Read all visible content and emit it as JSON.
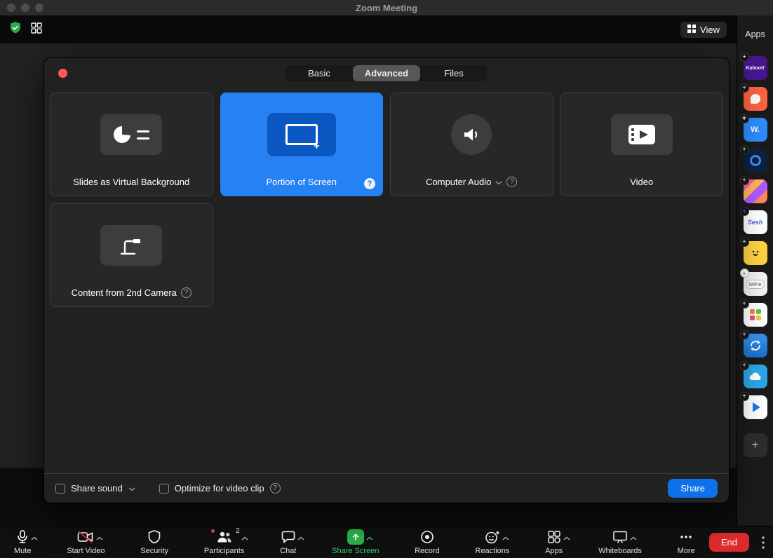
{
  "colors": {
    "selected_blue": "#2681f2",
    "share_button_blue": "#0e71eb",
    "share_screen_green": "#2bb24c",
    "end_red": "#dd2c2c",
    "security_shield_green": "#2ba84e"
  },
  "titlebar": {
    "title": "Zoom Meeting"
  },
  "topbar": {
    "view_label": "View"
  },
  "apps_sidebar": {
    "title": "Apps",
    "items": [
      {
        "name": "kahoot-app",
        "label": "Kahoot!"
      },
      {
        "name": "orange-app",
        "label": ""
      },
      {
        "name": "w-app",
        "label": "W."
      },
      {
        "name": "ring-app",
        "label": ""
      },
      {
        "name": "stripes-app",
        "label": ""
      },
      {
        "name": "sesh-app",
        "label": "Sesh"
      },
      {
        "name": "smiley-app",
        "label": ""
      },
      {
        "name": "twine-app",
        "label": "twine"
      },
      {
        "name": "color-tiles-app",
        "label": ""
      },
      {
        "name": "sync-app",
        "label": ""
      },
      {
        "name": "cloud-app",
        "label": ""
      },
      {
        "name": "play-app",
        "label": ""
      }
    ]
  },
  "share_dialog": {
    "tabs": [
      {
        "label": "Basic",
        "active": false
      },
      {
        "label": "Advanced",
        "active": true
      },
      {
        "label": "Files",
        "active": false
      }
    ],
    "tiles": [
      {
        "label": "Slides as Virtual Background",
        "selected": false
      },
      {
        "label": "Portion of Screen",
        "selected": true,
        "has_help": true
      },
      {
        "label": "Computer Audio",
        "selected": false,
        "has_dropdown": true,
        "has_help": true
      },
      {
        "label": "Video",
        "selected": false
      },
      {
        "label": "Content from 2nd Camera",
        "selected": false,
        "has_help": true
      }
    ],
    "footer": {
      "share_sound_label": "Share sound",
      "share_sound_checked": false,
      "optimize_label": "Optimize for video clip",
      "optimize_checked": false,
      "share_button_label": "Share"
    }
  },
  "toolbar": {
    "items": [
      {
        "label": "Mute",
        "icon": "microphone-icon",
        "caret": true
      },
      {
        "label": "Start Video",
        "icon": "video-camera-off-icon",
        "caret": true
      },
      {
        "label": "Security",
        "icon": "shield-icon",
        "caret": false
      },
      {
        "label": "Participants",
        "icon": "participants-icon",
        "caret": true,
        "badge": "2"
      },
      {
        "label": "Chat",
        "icon": "chat-bubble-icon",
        "caret": true
      },
      {
        "label": "Share Screen",
        "icon": "share-screen-icon",
        "caret": true,
        "active": true
      },
      {
        "label": "Record",
        "icon": "record-icon",
        "caret": false
      },
      {
        "label": "Reactions",
        "icon": "reactions-icon",
        "caret": true
      },
      {
        "label": "Apps",
        "icon": "apps-icon",
        "caret": true
      },
      {
        "label": "Whiteboards",
        "icon": "whiteboard-icon",
        "caret": true
      },
      {
        "label": "More",
        "icon": "more-icon",
        "caret": false
      }
    ],
    "end_label": "End"
  }
}
